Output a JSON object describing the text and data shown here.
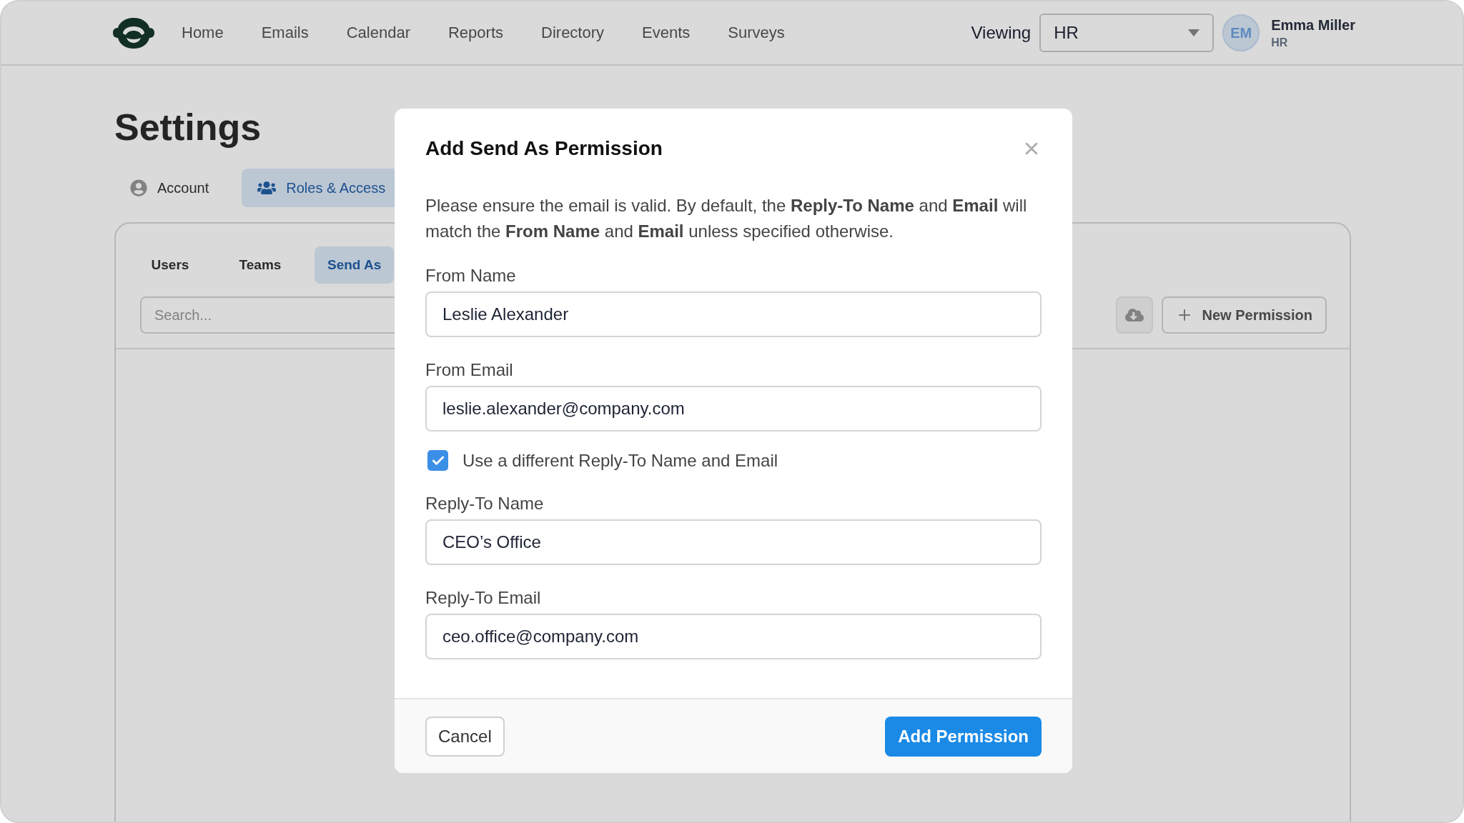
{
  "nav": {
    "items": [
      "Home",
      "Emails",
      "Calendar",
      "Reports",
      "Directory",
      "Events",
      "Surveys"
    ],
    "viewing_label": "Viewing",
    "viewing_value": "HR",
    "user": {
      "initials": "EM",
      "name": "Emma Miller",
      "role": "HR"
    }
  },
  "page_title": "Settings",
  "settings_tabs": [
    {
      "label": "Account",
      "kind": "account",
      "selected": false
    },
    {
      "label": "Roles & Access",
      "kind": "roles",
      "selected": true
    }
  ],
  "sub_tabs": [
    {
      "label": "Users",
      "selected": false
    },
    {
      "label": "Teams",
      "selected": false
    },
    {
      "label": "Send As",
      "selected": true
    }
  ],
  "search": {
    "placeholder": "Search..."
  },
  "new_permission_button": "New Permission",
  "modal": {
    "title": "Add Send As Permission",
    "description": "Please ensure the email is valid. By default, the **Reply-To Name** and **Email** will match the **From Name** and **Email** unless specified otherwise.",
    "fields": [
      {
        "kind": "text",
        "label": "From Name",
        "value": "Leslie Alexander"
      },
      {
        "kind": "text",
        "label": "From Email",
        "value": "leslie.alexander@company.com"
      },
      {
        "kind": "checkbox",
        "label": "Use a different Reply-To Name and Email",
        "checked": true
      },
      {
        "kind": "text",
        "label": "Reply-To Name",
        "value": "CEO’s Office"
      },
      {
        "kind": "text",
        "label": "Reply-To Email",
        "value": "ceo.office@company.com"
      }
    ],
    "cancel_button": "Cancel",
    "submit_button": "Add Permission"
  }
}
